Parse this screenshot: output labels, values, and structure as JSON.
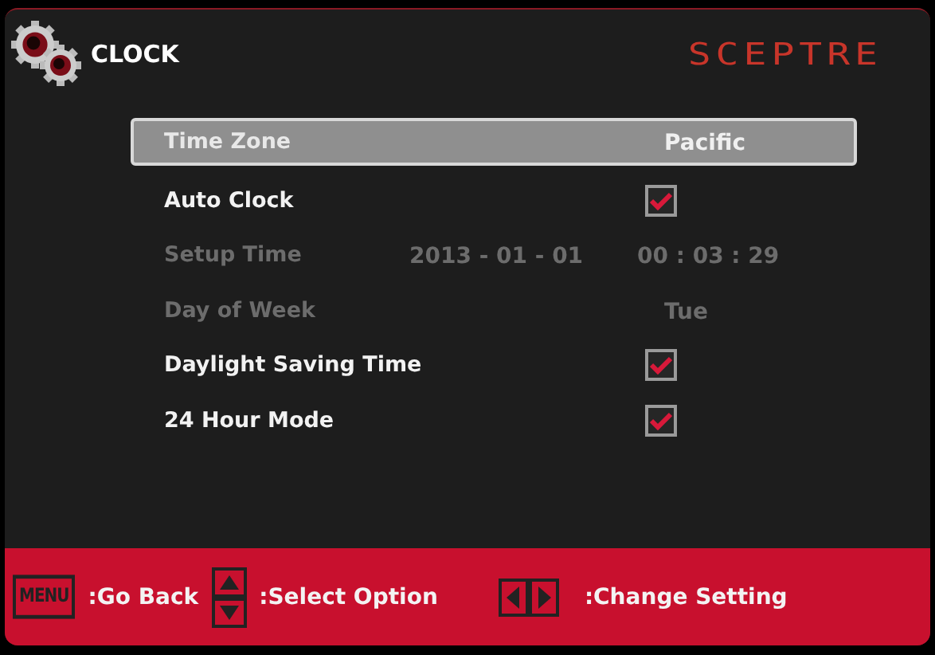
{
  "header": {
    "title": "CLOCK",
    "brand": "SCEPTRE"
  },
  "rows": [
    {
      "kind": "text",
      "label": "Time Zone",
      "value": "Pacific",
      "selected": true,
      "disabled": false
    },
    {
      "kind": "check",
      "label": "Auto Clock",
      "checked": true,
      "selected": false,
      "disabled": false
    },
    {
      "kind": "datetime",
      "label": "Setup Time",
      "date": "2013 - 01 - 01",
      "time": "00 : 03 : 29",
      "selected": false,
      "disabled": true
    },
    {
      "kind": "text",
      "label": "Day of Week",
      "value": "Tue",
      "selected": false,
      "disabled": true
    },
    {
      "kind": "check",
      "label": "Daylight Saving Time",
      "checked": true,
      "selected": false,
      "disabled": false
    },
    {
      "kind": "check",
      "label": "24 Hour Mode",
      "checked": true,
      "selected": false,
      "disabled": false
    }
  ],
  "footer": [
    {
      "kind": "menu",
      "key": "MENU",
      "label": ":Go Back"
    },
    {
      "kind": "updown",
      "label": ":Select Option"
    },
    {
      "kind": "leftright",
      "label": ":Change Setting"
    }
  ]
}
